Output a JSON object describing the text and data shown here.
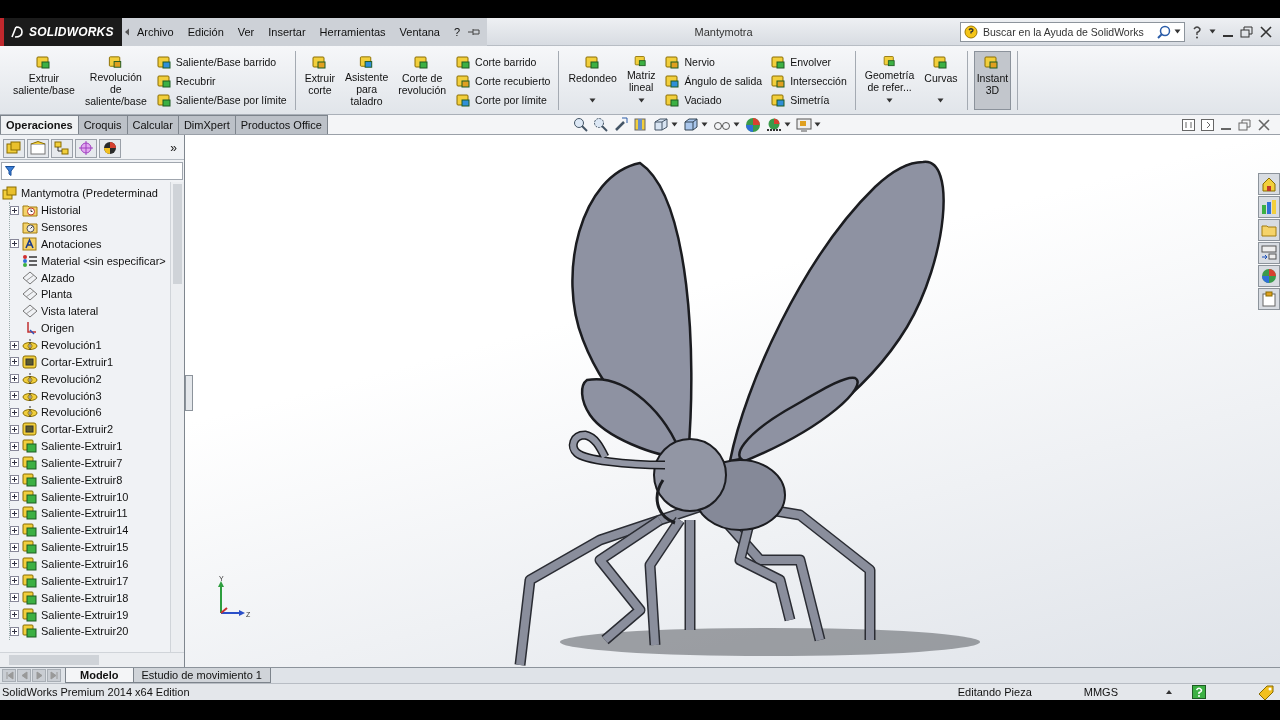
{
  "top_bar": {
    "logo": "SOLIDWORKS",
    "menu": [
      "Archivo",
      "Edición",
      "Ver",
      "Insertar",
      "Herramientas",
      "Ventana",
      "?"
    ],
    "title": "Mantymotra",
    "search": {
      "placeholder": "Buscar en la Ayuda de SolidWorks"
    }
  },
  "ribbon": {
    "groups": [
      {
        "items": [
          {
            "kind": "large",
            "label": "Extruir\nsaliente/base",
            "dropdown": false,
            "selected": false
          },
          {
            "kind": "large",
            "label": "Revolución\nde\nsaliente/base",
            "dropdown": false,
            "selected": false
          },
          {
            "kind": "stack",
            "buttons": [
              "Saliente/Base barrido",
              "Recubrir",
              "Saliente/Base por límite"
            ]
          }
        ]
      },
      {
        "items": [
          {
            "kind": "large",
            "label": "Extruir\ncorte",
            "dropdown": false,
            "selected": false
          },
          {
            "kind": "large",
            "label": "Asistente\npara\ntaladro",
            "dropdown": false,
            "selected": false
          },
          {
            "kind": "large",
            "label": "Corte de\nrevolución",
            "dropdown": false,
            "selected": false
          },
          {
            "kind": "stack",
            "buttons": [
              "Corte barrido",
              "Corte recubierto",
              "Corte por límite"
            ]
          }
        ]
      },
      {
        "items": [
          {
            "kind": "large",
            "label": "Redondeo",
            "dropdown": true,
            "selected": false
          },
          {
            "kind": "large",
            "label": "Matriz\nlineal",
            "dropdown": true,
            "selected": false
          },
          {
            "kind": "stack",
            "buttons": [
              "Nervio",
              "Ángulo de salida",
              "Vaciado"
            ]
          },
          {
            "kind": "stack",
            "buttons": [
              "Envolver",
              "Intersección",
              "Simetría"
            ]
          }
        ]
      },
      {
        "items": [
          {
            "kind": "large",
            "label": "Geometría\nde refer...",
            "dropdown": true,
            "selected": false
          },
          {
            "kind": "large",
            "label": "Curvas",
            "dropdown": true,
            "selected": false
          }
        ]
      },
      {
        "items": [
          {
            "kind": "large",
            "label": "Instant\n3D",
            "dropdown": false,
            "selected": true
          }
        ]
      }
    ]
  },
  "tabs": [
    {
      "label": "Operaciones",
      "selected": true
    },
    {
      "label": "Croquis",
      "selected": false
    },
    {
      "label": "Calcular",
      "selected": false
    },
    {
      "label": "DimXpert",
      "selected": false
    },
    {
      "label": "Productos Office",
      "selected": false
    }
  ],
  "feature_tree": {
    "panel_more": "»",
    "root": {
      "label": "Mantymotra  (Predeterminad",
      "children": [
        {
          "label": "Historial",
          "kind": "history",
          "expandable": true
        },
        {
          "label": "Sensores",
          "kind": "sensors",
          "expandable": false
        },
        {
          "label": "Anotaciones",
          "kind": "annotations",
          "expandable": true
        },
        {
          "label": "Material <sin especificar>",
          "kind": "material",
          "expandable": false
        },
        {
          "label": "Alzado",
          "kind": "plane",
          "expandable": false
        },
        {
          "label": "Planta",
          "kind": "plane",
          "expandable": false
        },
        {
          "label": "Vista lateral",
          "kind": "plane",
          "expandable": false
        },
        {
          "label": "Origen",
          "kind": "origin",
          "expandable": false
        },
        {
          "label": "Revolución1",
          "kind": "revolve",
          "expandable": true
        },
        {
          "label": "Cortar-Extruir1",
          "kind": "cut",
          "expandable": true
        },
        {
          "label": "Revolución2",
          "kind": "revolve",
          "expandable": true
        },
        {
          "label": "Revolución3",
          "kind": "revolve",
          "expandable": true
        },
        {
          "label": "Revolución6",
          "kind": "revolve",
          "expandable": true
        },
        {
          "label": "Cortar-Extruir2",
          "kind": "cut",
          "expandable": true
        },
        {
          "label": "Saliente-Extruir1",
          "kind": "boss",
          "expandable": true
        },
        {
          "label": "Saliente-Extruir7",
          "kind": "boss",
          "expandable": true
        },
        {
          "label": "Saliente-Extruir8",
          "kind": "boss",
          "expandable": true
        },
        {
          "label": "Saliente-Extruir10",
          "kind": "boss",
          "expandable": true
        },
        {
          "label": "Saliente-Extruir11",
          "kind": "boss",
          "expandable": true
        },
        {
          "label": "Saliente-Extruir14",
          "kind": "boss",
          "expandable": true
        },
        {
          "label": "Saliente-Extruir15",
          "kind": "boss",
          "expandable": true
        },
        {
          "label": "Saliente-Extruir16",
          "kind": "boss",
          "expandable": true
        },
        {
          "label": "Saliente-Extruir17",
          "kind": "boss",
          "expandable": true
        },
        {
          "label": "Saliente-Extruir18",
          "kind": "boss",
          "expandable": true
        },
        {
          "label": "Saliente-Extruir19",
          "kind": "boss",
          "expandable": true
        },
        {
          "label": "Saliente-Extruir20",
          "kind": "boss",
          "expandable": true
        }
      ]
    }
  },
  "triad": {
    "y_label": "Y",
    "z_label": "Z"
  },
  "bottom_tabs": [
    {
      "label": "Modelo",
      "selected": true
    },
    {
      "label": "Estudio de movimiento 1",
      "selected": false
    }
  ],
  "status_bar": {
    "product": "SolidWorks Premium 2014 x64 Edition",
    "mode": "Editando Pieza",
    "units": "MMGS"
  }
}
